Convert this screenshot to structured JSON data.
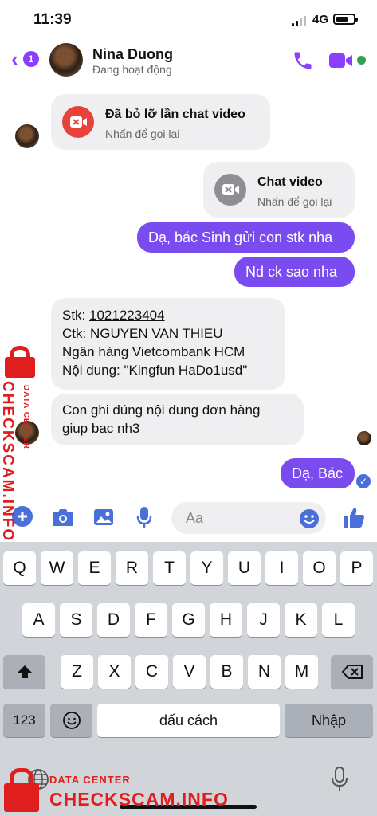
{
  "status_bar": {
    "time": "11:39",
    "network": "4G",
    "battery_fraction": 0.7
  },
  "header": {
    "back_badge_count": "1",
    "contact_name": "Nina Duong",
    "presence": "Đang hoạt động",
    "icons": [
      "back-chevron-icon",
      "phone-icon",
      "video-camera-icon",
      "active-dot"
    ]
  },
  "messages": [
    {
      "type": "call",
      "direction": "incoming",
      "title": "Đã bỏ lỡ lần chat video",
      "subtitle": "Nhấn để gọi lại",
      "icon": "missed-video-call-icon",
      "icon_color": "#e9423b"
    },
    {
      "type": "call",
      "direction": "outgoing",
      "title": "Chat video",
      "subtitle": "Nhấn để gọi lại",
      "icon": "video-call-icon",
      "icon_color": "#8e8e93"
    },
    {
      "type": "text",
      "direction": "outgoing",
      "text": "Dạ, bác Sinh gửi con stk nha"
    },
    {
      "type": "text",
      "direction": "outgoing",
      "text": "Nd ck sao nha"
    },
    {
      "type": "text",
      "direction": "incoming",
      "lines": {
        "stk_label": "Stk: ",
        "stk_value": "1021223404",
        "ctk": "Ctk: NGUYEN VAN THIEU",
        "bank": "Ngân hàng Vietcombank HCM",
        "content": "Nội dung: \"Kingfun HaDo1usd\""
      }
    },
    {
      "type": "text",
      "direction": "incoming",
      "lines": [
        "Con ghi đúng nội dung đơn hàng",
        "giup bac nh3"
      ]
    },
    {
      "type": "text",
      "direction": "outgoing",
      "text": "Dạ, Bác",
      "status": "sent-check-icon"
    }
  ],
  "composer": {
    "placeholder": "Aa",
    "icons": [
      "plus-icon",
      "camera-icon",
      "gallery-icon",
      "microphone-icon",
      "emoji-icon",
      "thumbs-up-icon"
    ]
  },
  "keyboard": {
    "row1": [
      "Q",
      "W",
      "E",
      "R",
      "T",
      "Y",
      "U",
      "I",
      "O",
      "P"
    ],
    "row2": [
      "A",
      "S",
      "D",
      "F",
      "G",
      "H",
      "J",
      "K",
      "L"
    ],
    "row3": [
      "Z",
      "X",
      "C",
      "V",
      "B",
      "N",
      "M"
    ],
    "numbers_key": "123",
    "space_key": "dấu cách",
    "return_key": "Nhập",
    "icons": [
      "shift-icon",
      "backspace-icon",
      "emoji-icon",
      "globe-icon",
      "dictation-mic-icon"
    ]
  },
  "watermark": {
    "vertical_small": "DATA CENTER",
    "vertical_large": "CHECKSCAM.INFO",
    "bottom_small": "DATA CENTER",
    "bottom_large": "CHECKSCAM.INFO"
  },
  "colors": {
    "accent": "#8a3ffc",
    "outgoing_bubble": "#7a4cf0",
    "incoming_bubble": "#efeff1",
    "watermark": "#e01e1e",
    "active": "#31a24c"
  }
}
